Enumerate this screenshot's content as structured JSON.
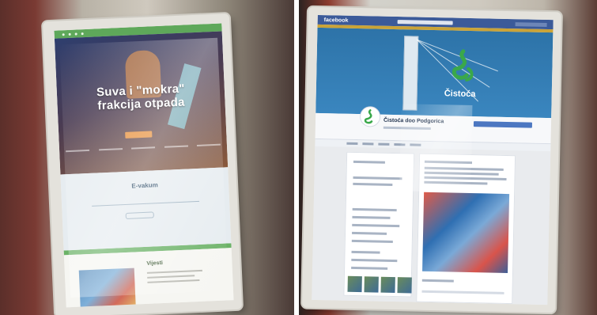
{
  "left_kiosk": {
    "hero": {
      "title": "Suva i \"mokra\" frakcija otpada"
    },
    "evakum": {
      "title": "E-vakum"
    },
    "content": {
      "title": "Vijesti"
    }
  },
  "right_kiosk": {
    "facebook": {
      "logo": "facebook",
      "cover_name": "Čistoća",
      "page_name": "Čistoća doo Podgorica"
    }
  },
  "colors": {
    "left_topbar": "#5ea85a",
    "left_cta": "#e7903b",
    "facebook_blue": "#3b5a99",
    "cover_blue": "#2d73a8",
    "logo_green": "#3aa84a"
  }
}
